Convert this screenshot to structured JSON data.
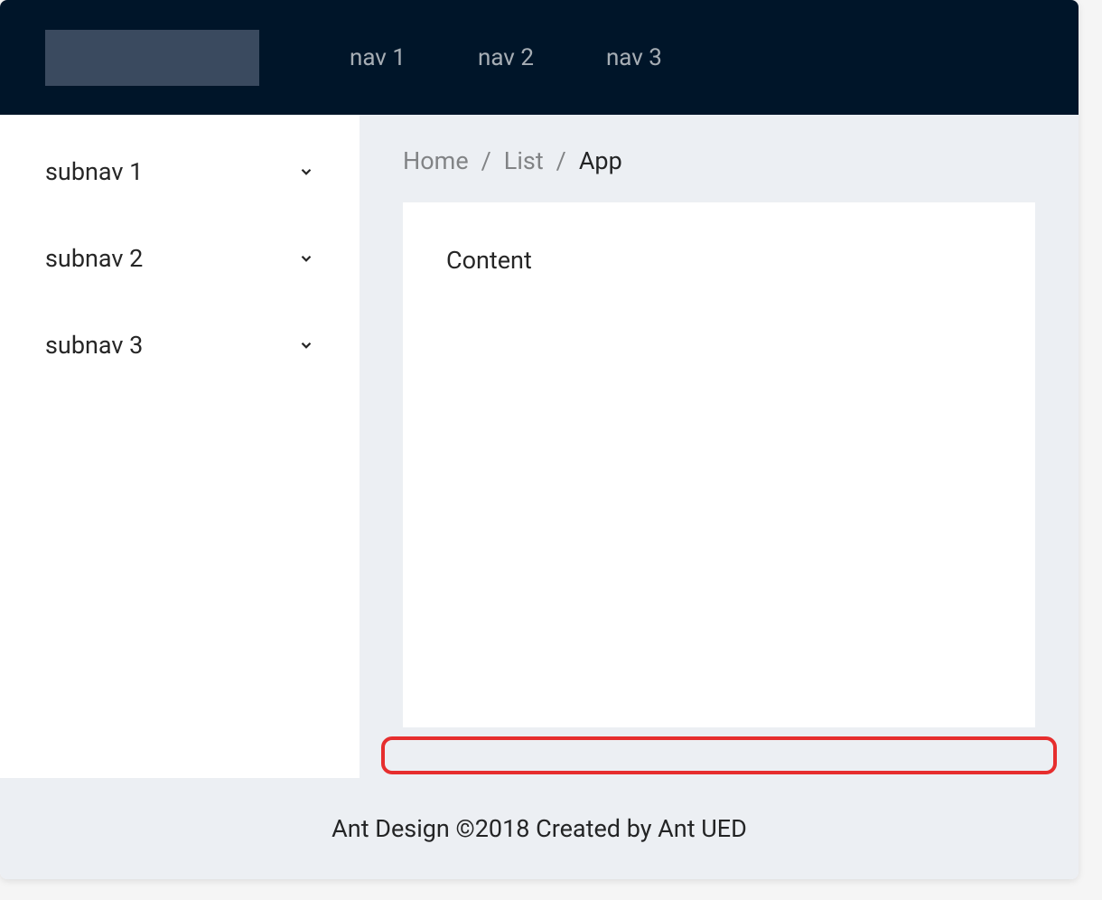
{
  "header": {
    "nav_items": [
      {
        "label": "nav 1"
      },
      {
        "label": "nav 2"
      },
      {
        "label": "nav 3"
      }
    ]
  },
  "sidebar": {
    "items": [
      {
        "label": "subnav 1"
      },
      {
        "label": "subnav 2"
      },
      {
        "label": "subnav 3"
      }
    ]
  },
  "breadcrumb": {
    "items": [
      {
        "label": "Home",
        "current": false
      },
      {
        "label": "List",
        "current": false
      },
      {
        "label": "App",
        "current": true
      }
    ],
    "separator": "/"
  },
  "content": {
    "text": "Content"
  },
  "footer": {
    "text": "Ant Design ©2018 Created by Ant UED"
  }
}
